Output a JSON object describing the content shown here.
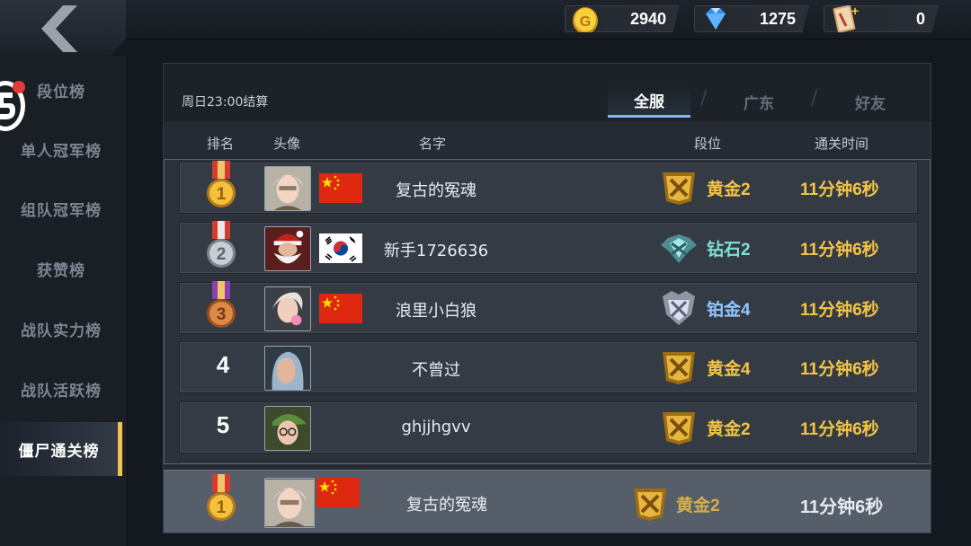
{
  "topbar": {
    "back_icon": "chevron-left-icon",
    "currencies": [
      {
        "icon": "gold-coin-icon",
        "amount": "2940"
      },
      {
        "icon": "diamond-icon",
        "amount": "1275"
      },
      {
        "icon": "card-plus-icon",
        "amount": "0"
      }
    ]
  },
  "sidebar": {
    "items": [
      {
        "label": "段位榜"
      },
      {
        "label": "单人冠军榜"
      },
      {
        "label": "组队冠军榜"
      },
      {
        "label": "获赞榜"
      },
      {
        "label": "战队实力榜"
      },
      {
        "label": "战队活跃榜"
      },
      {
        "label": "僵尸通关榜"
      }
    ],
    "active_index": 6
  },
  "panel": {
    "settle_text": "周日23:00结算",
    "tabs": [
      {
        "label": "全服",
        "active": true
      },
      {
        "label": "广东",
        "active": false
      },
      {
        "label": "好友",
        "active": false
      }
    ],
    "columns": {
      "rank": "排名",
      "avatar": "头像",
      "name": "名字",
      "tier": "段位",
      "time": "通关时间"
    }
  },
  "rows": [
    {
      "rank": "1",
      "medal": "gold",
      "flag": "china",
      "name": "复古的冤魂",
      "tier": "黄金2",
      "tier_kind": "gold",
      "time": "11分钟6秒"
    },
    {
      "rank": "2",
      "medal": "silver",
      "flag": "korea",
      "name": "新手1726636",
      "tier": "钻石2",
      "tier_kind": "diamond",
      "time": "11分钟6秒"
    },
    {
      "rank": "3",
      "medal": "bronze",
      "flag": "china",
      "name": "浪里小白狼",
      "tier": "铂金4",
      "tier_kind": "platinum",
      "time": "11分钟6秒"
    },
    {
      "rank": "4",
      "medal": "",
      "flag": "",
      "name": "不曾过",
      "tier": "黄金4",
      "tier_kind": "gold",
      "time": "11分钟6秒"
    },
    {
      "rank": "5",
      "medal": "",
      "flag": "",
      "name": "ghjjhgvv",
      "tier": "黄金2",
      "tier_kind": "gold",
      "time": "11分钟6秒"
    }
  ],
  "my_row": {
    "rank": "1",
    "medal": "gold",
    "flag": "china",
    "name": "复古的冤魂",
    "tier": "黄金2",
    "time": "11分钟6秒"
  },
  "colors": {
    "accent_gold": "#f4c544",
    "diamond_text": "#7fe0d8",
    "platinum_text": "#8fc7ff",
    "tab_active_underline": "#7fb8ff",
    "sidebar_active_bar": "#f3c24a"
  }
}
